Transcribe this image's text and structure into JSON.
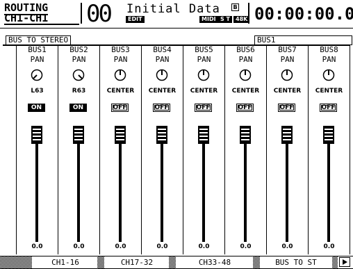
{
  "header": {
    "function": "ROUTING",
    "channel": "CH1-CH1",
    "scene_number": "00",
    "scene_title": "Initial Data",
    "edit_badge": "EDIT",
    "protect_badge": "B",
    "midi_badge": "MIDI",
    "st_badge": "S T",
    "fs_badge": "48K",
    "timecode": "00:00:00.00"
  },
  "labels": {
    "left": "BUS TO STEREO",
    "right": "BUS1"
  },
  "buses": [
    {
      "name": "BUS1",
      "pan_label": "PAN",
      "pan_value": "L63",
      "switch": "ON",
      "level": "0.0"
    },
    {
      "name": "BUS2",
      "pan_label": "PAN",
      "pan_value": "R63",
      "switch": "ON",
      "level": "0.0"
    },
    {
      "name": "BUS3",
      "pan_label": "PAN",
      "pan_value": "CENTER",
      "switch": "OFF",
      "level": "0.0"
    },
    {
      "name": "BUS4",
      "pan_label": "PAN",
      "pan_value": "CENTER",
      "switch": "OFF",
      "level": "0.0"
    },
    {
      "name": "BUS5",
      "pan_label": "PAN",
      "pan_value": "CENTER",
      "switch": "OFF",
      "level": "0.0"
    },
    {
      "name": "BUS6",
      "pan_label": "PAN",
      "pan_value": "CENTER",
      "switch": "OFF",
      "level": "0.0"
    },
    {
      "name": "BUS7",
      "pan_label": "PAN",
      "pan_value": "CENTER",
      "switch": "OFF",
      "level": "0.0"
    },
    {
      "name": "BUS8",
      "pan_label": "PAN",
      "pan_value": "CENTER",
      "switch": "OFF",
      "level": "0.0"
    }
  ],
  "tabs": [
    {
      "label": "CH1-16",
      "active": false
    },
    {
      "label": "CH17-32",
      "active": false
    },
    {
      "label": "CH33-48",
      "active": false
    },
    {
      "label": "BUS TO ST",
      "active": true
    }
  ],
  "tab_more_icon": "triangle-right-icon"
}
